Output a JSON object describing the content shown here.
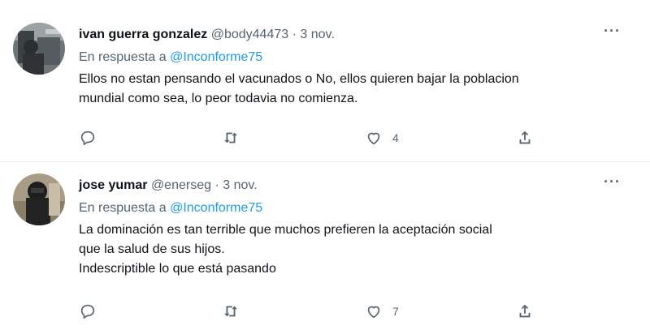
{
  "tweets": [
    {
      "name": "ivan guerra gonzalez",
      "handle": "@body44473",
      "dot": "·",
      "date": "3 nov.",
      "replying_prefix": "En respuesta a",
      "replying_to": "@Inconforme75",
      "text_lines": [
        "Ellos no estan pensando el vacunados o No, ellos quieren bajar la poblacion",
        "mundial como sea, lo peor todavia no comienza."
      ],
      "more": "···",
      "reply_count": "",
      "retweet_count": "",
      "like_count": "4"
    },
    {
      "name": "jose yumar",
      "handle": "@enerseg",
      "dot": "·",
      "date": "3 nov.",
      "replying_prefix": "En respuesta a",
      "replying_to": "@Inconforme75",
      "text_lines": [
        "La dominación es tan terrible que muchos prefieren la aceptación social",
        "que la salud de sus hijos.",
        "Indescriptible lo que está pasando"
      ],
      "more": "···",
      "reply_count": "",
      "retweet_count": "",
      "like_count": "7"
    }
  ],
  "icons": {
    "reply": "reply-icon",
    "retweet": "retweet-icon",
    "like": "heart-icon",
    "share": "share-icon",
    "more": "more-icon"
  },
  "colors": {
    "mention": "#1d9bf0",
    "secondary_text": "#536471",
    "primary_text": "#0f1419",
    "divider": "#e6ecf0"
  }
}
